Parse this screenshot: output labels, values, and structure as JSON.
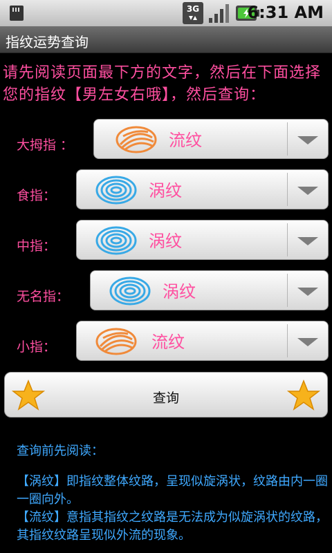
{
  "status_bar": {
    "time": "6:31 AM",
    "network": "3G"
  },
  "title": "指纹运势查询",
  "instruction": "请先阅读页面最下方的文字，然后在下面选择您的指纹【男左女右哦】，然后查询：",
  "fingers": [
    {
      "label": "大拇指 ：",
      "value": "流纹",
      "pattern_color": "#f08a3a"
    },
    {
      "label": "食指：",
      "value": "涡纹",
      "pattern_color": "#38a9e6"
    },
    {
      "label": "中指：",
      "value": "涡纹",
      "pattern_color": "#38a9e6"
    },
    {
      "label": "无名指：",
      "value": "涡纹",
      "pattern_color": "#38a9e6"
    },
    {
      "label": "小指：",
      "value": "流纹",
      "pattern_color": "#f08a3a"
    }
  ],
  "query_button": "查询",
  "notes_title": "查询前先阅读：",
  "notes": [
    "【涡纹】即指纹整体纹路，呈现似旋涡状，纹路由内一圈一圈向外。",
    "【流纹】意指其指纹之纹路是无法成为似旋涡状的纹路，其指纹纹路呈现似外流的现象。"
  ],
  "colors": {
    "accent_pink": "#ff4fa0",
    "note_blue": "#3fa9ff"
  }
}
